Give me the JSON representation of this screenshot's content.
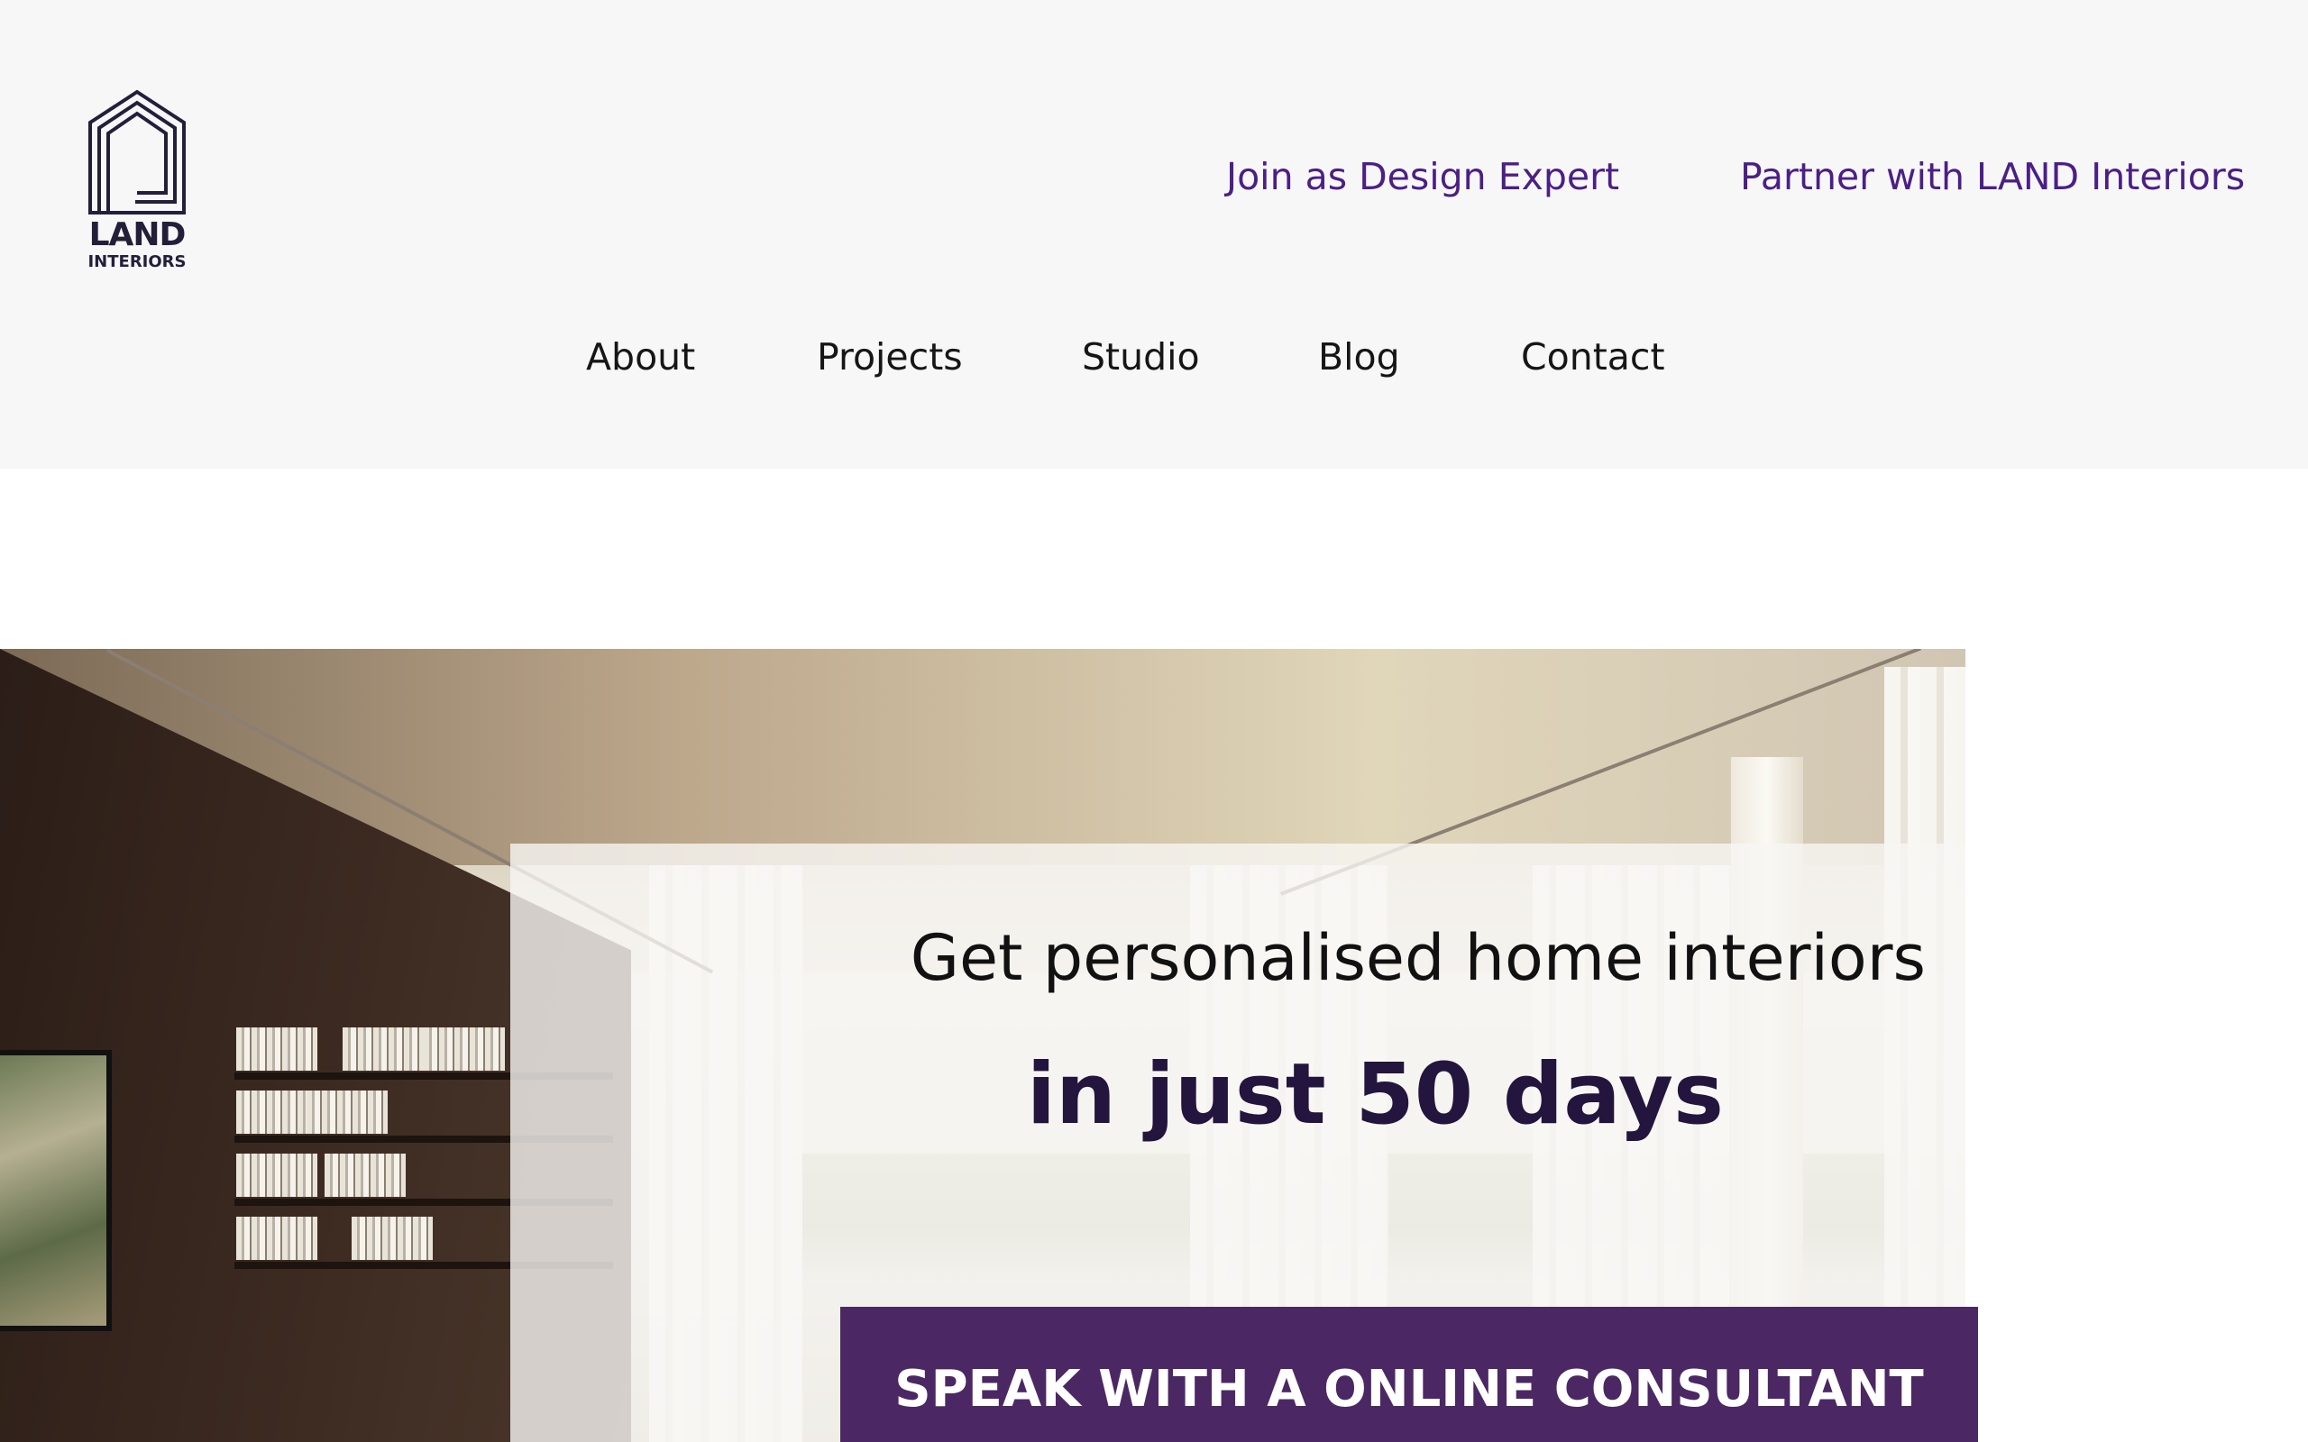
{
  "brand": {
    "logo_icon": "house-outline-icon",
    "name": "LAND",
    "tagline": "INTERIORS"
  },
  "top_links": {
    "design_expert": "Join as Design Expert",
    "partner": "Partner with LAND Interiors"
  },
  "nav": {
    "about": "About",
    "projects": "Projects",
    "studio": "Studio",
    "blog": "Blog",
    "contact": "Contact"
  },
  "hero": {
    "headline": "Get personalised home interiors",
    "subheadline": "in just 50 days",
    "cta": "SPEAK WITH A ONLINE CONSULTANT"
  },
  "colors": {
    "header_bg": "#f7f7f8",
    "accent_link": "#4b1f86",
    "cta_bg": "#4b2863",
    "subheadline": "#23153d",
    "logo": "#231f3a"
  }
}
